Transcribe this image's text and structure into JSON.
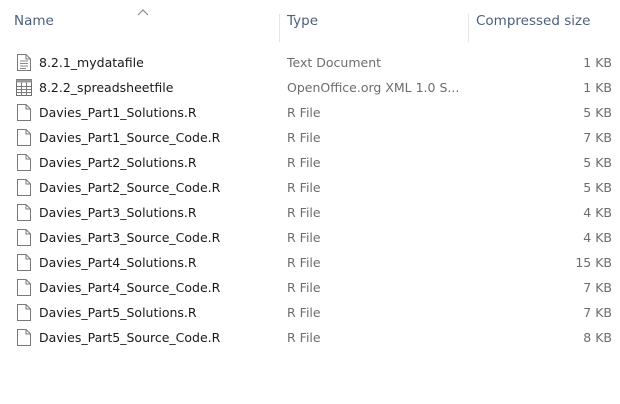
{
  "columns": {
    "name": "Name",
    "type": "Type",
    "compressed_size": "Compressed size",
    "sort_column": "name"
  },
  "files": [
    {
      "name": "8.2.1_mydatafile",
      "type": "Text Document",
      "size": "1 KB",
      "icon": "text-document-icon"
    },
    {
      "name": "8.2.2_spreadsheetfile",
      "type": "OpenOffice.org XML 1.0 S...",
      "size": "1 KB",
      "icon": "spreadsheet-icon"
    },
    {
      "name": "Davies_Part1_Solutions.R",
      "type": "R File",
      "size": "5 KB",
      "icon": "file-icon"
    },
    {
      "name": "Davies_Part1_Source_Code.R",
      "type": "R File",
      "size": "7 KB",
      "icon": "file-icon"
    },
    {
      "name": "Davies_Part2_Solutions.R",
      "type": "R File",
      "size": "5 KB",
      "icon": "file-icon"
    },
    {
      "name": "Davies_Part2_Source_Code.R",
      "type": "R File",
      "size": "5 KB",
      "icon": "file-icon"
    },
    {
      "name": "Davies_Part3_Solutions.R",
      "type": "R File",
      "size": "4 KB",
      "icon": "file-icon"
    },
    {
      "name": "Davies_Part3_Source_Code.R",
      "type": "R File",
      "size": "4 KB",
      "icon": "file-icon"
    },
    {
      "name": "Davies_Part4_Solutions.R",
      "type": "R File",
      "size": "15 KB",
      "icon": "file-icon"
    },
    {
      "name": "Davies_Part4_Source_Code.R",
      "type": "R File",
      "size": "7 KB",
      "icon": "file-icon"
    },
    {
      "name": "Davies_Part5_Solutions.R",
      "type": "R File",
      "size": "7 KB",
      "icon": "file-icon"
    },
    {
      "name": "Davies_Part5_Source_Code.R",
      "type": "R File",
      "size": "8 KB",
      "icon": "file-icon"
    }
  ]
}
